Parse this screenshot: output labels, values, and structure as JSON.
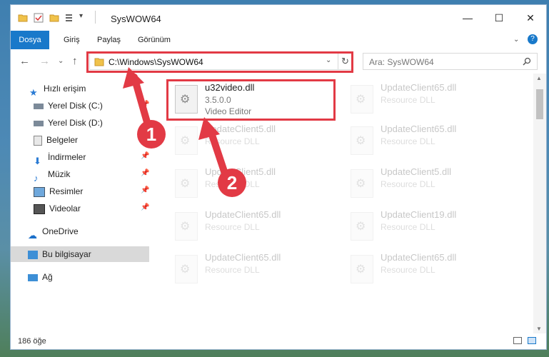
{
  "window": {
    "title": "SysWOW64",
    "minimize": "—",
    "maximize": "☐",
    "close": "✕"
  },
  "ribbon": {
    "tabs": [
      "Dosya",
      "Giriş",
      "Paylaş",
      "Görünüm"
    ],
    "help": "?"
  },
  "address": {
    "path": "C:\\Windows\\SysWOW64",
    "search_placeholder": "Ara: SysWOW64"
  },
  "nav": {
    "items": [
      {
        "label": "Hızlı erişim",
        "icon": "star-icon"
      },
      {
        "label": "Yerel Disk (C:)",
        "icon": "drive-icon"
      },
      {
        "label": "Yerel Disk (D:)",
        "icon": "drive-icon"
      },
      {
        "label": "Belgeler",
        "icon": "document-icon"
      },
      {
        "label": "İndirmeler",
        "icon": "download-icon"
      },
      {
        "label": "Müzik",
        "icon": "music-icon"
      },
      {
        "label": "Resimler",
        "icon": "pictures-icon"
      },
      {
        "label": "Videolar",
        "icon": "video-icon"
      },
      {
        "label": "OneDrive",
        "icon": "cloud-icon"
      },
      {
        "label": "Bu bilgisayar",
        "icon": "computer-icon"
      },
      {
        "label": "Ağ",
        "icon": "network-icon"
      }
    ]
  },
  "files": [
    {
      "name": "u32video.dll",
      "line1": "3.5.0.0",
      "line2": "Video Editor"
    },
    {
      "name": "UpdateClient65.dll",
      "line1": "Resource DLL",
      "line2": ""
    },
    {
      "name": "UpdateClient5.dll",
      "line1": "Resource DLL",
      "line2": ""
    },
    {
      "name": "UpdateClient65.dll",
      "line1": "Resource DLL",
      "line2": ""
    },
    {
      "name": "UpdateClient5.dll",
      "line1": "Resource DLL",
      "line2": ""
    },
    {
      "name": "UpdateClient5.dll",
      "line1": "Resource DLL",
      "line2": ""
    },
    {
      "name": "UpdateClient65.dll",
      "line1": "Resource DLL",
      "line2": ""
    },
    {
      "name": "UpdateClient19.dll",
      "line1": "Resource DLL",
      "line2": ""
    },
    {
      "name": "UpdateClient65.dll",
      "line1": "Resource DLL",
      "line2": ""
    },
    {
      "name": "UpdateClient65.dll",
      "line1": "Resource DLL",
      "line2": ""
    }
  ],
  "status": {
    "count": "186 öğe"
  },
  "annotations": {
    "badge1": "1",
    "badge2": "2",
    "accent": "#e23a45"
  }
}
